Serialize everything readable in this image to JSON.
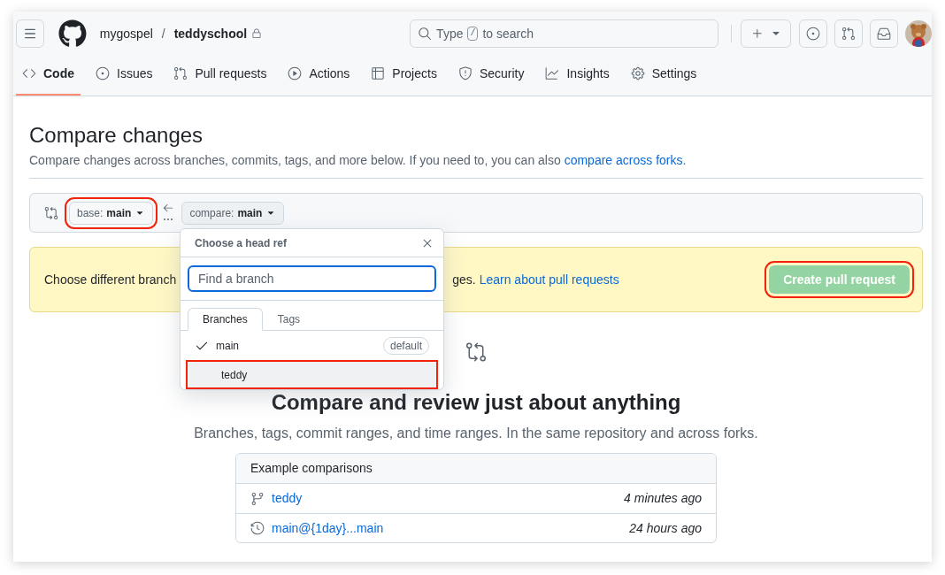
{
  "header": {
    "owner": "mygospel",
    "separator": "/",
    "repo": "teddyschool",
    "private": true,
    "search": {
      "before": "Type",
      "key": "/",
      "after": "to search"
    }
  },
  "tabs": [
    {
      "label": "Code",
      "kind": "code",
      "selected": true
    },
    {
      "label": "Issues",
      "kind": "issues",
      "selected": false
    },
    {
      "label": "Pull requests",
      "kind": "pulls",
      "selected": false
    },
    {
      "label": "Actions",
      "kind": "actions",
      "selected": false
    },
    {
      "label": "Projects",
      "kind": "projects",
      "selected": false
    },
    {
      "label": "Security",
      "kind": "security",
      "selected": false
    },
    {
      "label": "Insights",
      "kind": "insights",
      "selected": false
    },
    {
      "label": "Settings",
      "kind": "settings",
      "selected": false
    }
  ],
  "page": {
    "title": "Compare changes",
    "subtitle": "Compare changes across branches, commits, tags, and more below. If you need to, you can also",
    "subtitle_link": "compare across forks",
    "subtitle_end": "."
  },
  "range": {
    "base": {
      "prefix": "base:",
      "branch": "main",
      "highlighted": true
    },
    "compare": {
      "prefix": "compare:",
      "branch": "main",
      "highlighted": false
    }
  },
  "flash": {
    "text_visible": "Choose different branch",
    "text_after": "ges.",
    "link": "Learn about pull requests",
    "button": {
      "label": "Create pull request",
      "disabled": true,
      "highlighted": true
    }
  },
  "dropdown": {
    "title": "Choose a head ref",
    "placeholder": "Find a branch",
    "tabs": [
      {
        "label": "Branches",
        "selected": true
      },
      {
        "label": "Tags",
        "selected": false
      }
    ],
    "items": [
      {
        "name": "main",
        "checked": true,
        "badge": "default",
        "highlighted": false
      },
      {
        "name": "teddy",
        "checked": false,
        "highlighted": true
      }
    ]
  },
  "blankslate": {
    "heading": "Compare and review just about anything",
    "text": "Branches, tags, commit ranges, and time ranges. In the same repository and across forks."
  },
  "examples": {
    "title": "Example comparisons",
    "rows": [
      {
        "kind": "branch",
        "label": "teddy",
        "time": "4 minutes ago"
      },
      {
        "kind": "history",
        "label": "main@{1day}...main",
        "time": "24 hours ago"
      }
    ]
  }
}
